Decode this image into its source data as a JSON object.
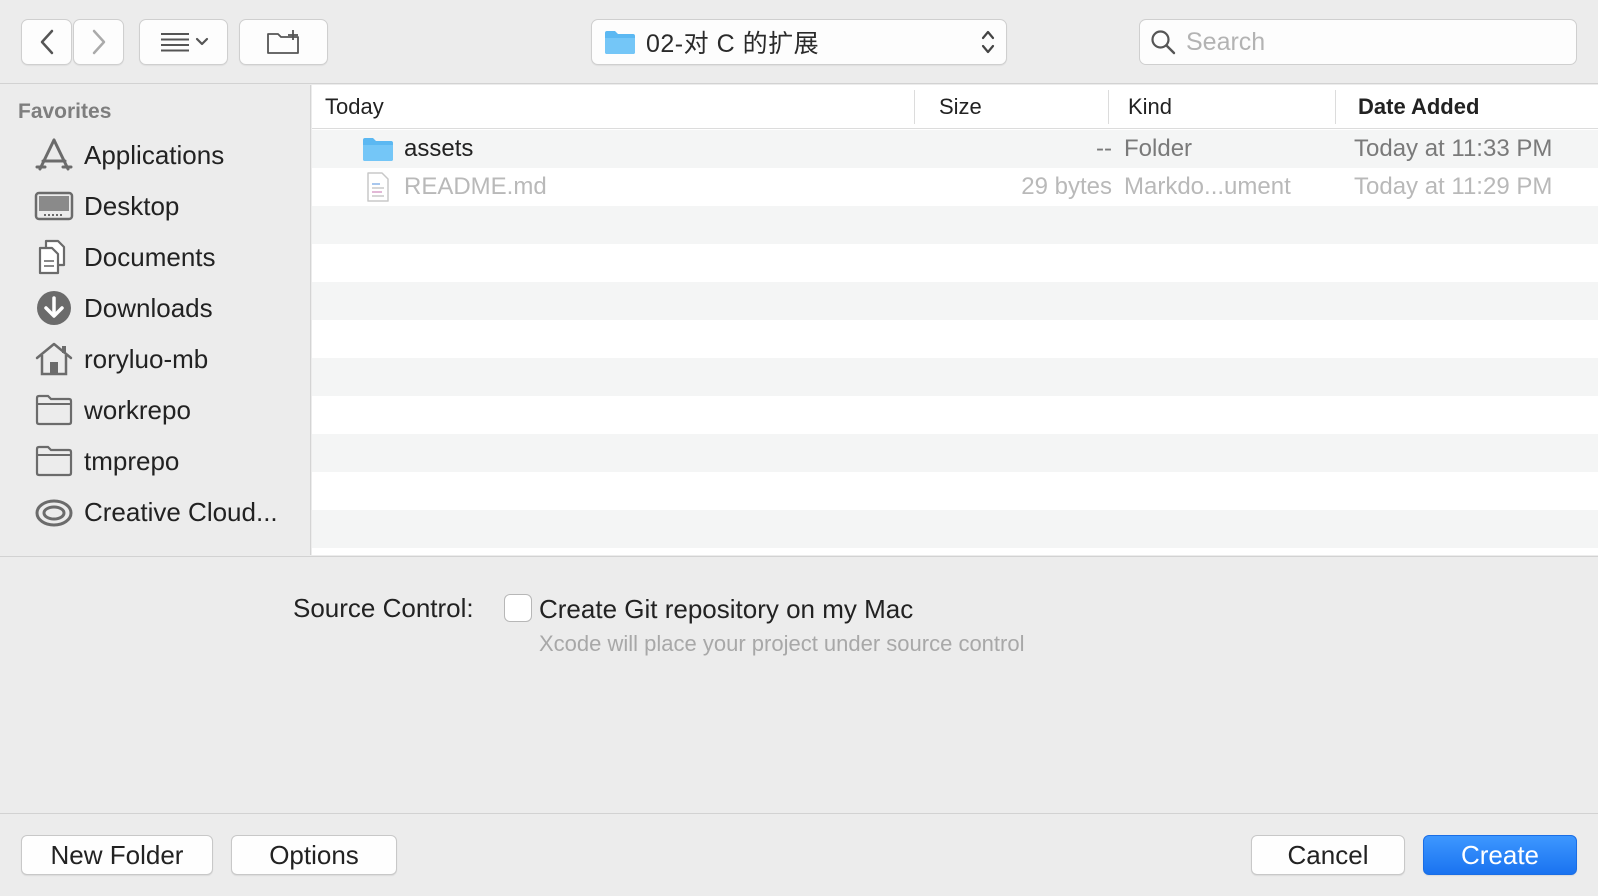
{
  "toolbar": {
    "back_icon": "chevron-left-icon",
    "forward_icon": "chevron-right-icon",
    "view_icon": "list-view-icon",
    "new_folder_icon": "new-folder-icon",
    "path_label": "02-对 C 的扩展",
    "search_placeholder": "Search"
  },
  "sidebar": {
    "heading": "Favorites",
    "items": [
      {
        "label": "Applications",
        "icon": "applications-icon"
      },
      {
        "label": "Desktop",
        "icon": "desktop-icon"
      },
      {
        "label": "Documents",
        "icon": "documents-icon"
      },
      {
        "label": "Downloads",
        "icon": "downloads-icon"
      },
      {
        "label": "roryluo-mb",
        "icon": "home-icon"
      },
      {
        "label": "workrepo",
        "icon": "folder-icon"
      },
      {
        "label": "tmprepo",
        "icon": "folder-icon"
      },
      {
        "label": "Creative Cloud...",
        "icon": "creative-cloud-icon"
      }
    ]
  },
  "filelist": {
    "columns": {
      "name": "Today",
      "size": "Size",
      "kind": "Kind",
      "date": "Date Added"
    },
    "rows": [
      {
        "name": "assets",
        "size": "--",
        "kind": "Folder",
        "date": "Today at 11:33 PM",
        "icon": "folder-icon"
      },
      {
        "name": "README.md",
        "size": "29 bytes",
        "kind": "Markdo...ument",
        "date": "Today at 11:29 PM",
        "icon": "document-icon"
      }
    ]
  },
  "source_control": {
    "label": "Source Control:",
    "checkbox_label": "Create Git repository on my Mac",
    "hint": "Xcode will place your project under source control",
    "checked": false
  },
  "buttons": {
    "new_folder": "New Folder",
    "options": "Options",
    "cancel": "Cancel",
    "create": "Create"
  },
  "colors": {
    "accent": "#1a73f0",
    "folder_blue": "#5bb8f2"
  }
}
